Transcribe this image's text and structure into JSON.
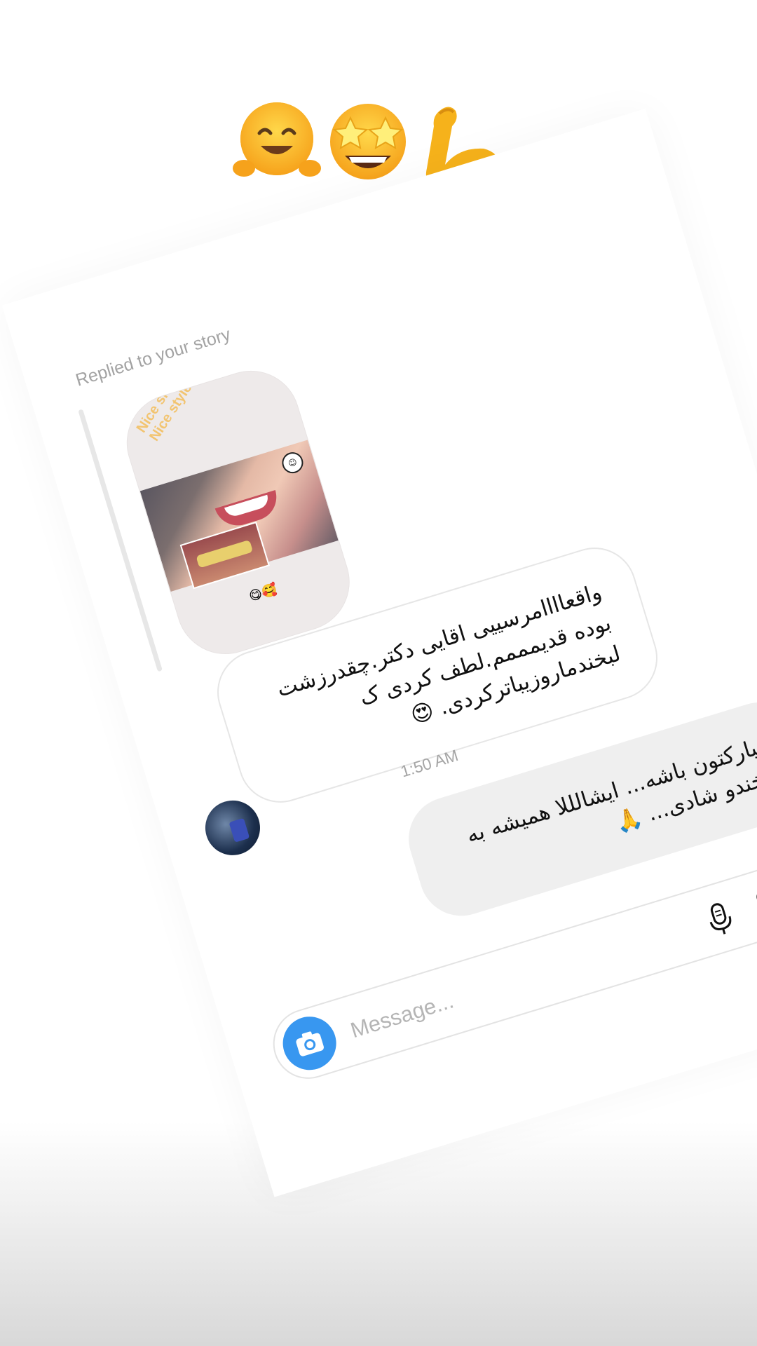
{
  "stickers": [
    {
      "icon": "hugging-face-emoji",
      "glyph": "🤗"
    },
    {
      "icon": "star-struck-emoji",
      "glyph": "🤩"
    },
    {
      "icon": "flexed-biceps-emoji",
      "glyph": "💪"
    }
  ],
  "thread": {
    "replied_label": "Replied to your story",
    "story": {
      "caption_line1": "Nice smile",
      "caption_line2": "Nice style",
      "emoji": "😋🥰"
    },
    "incoming_message": {
      "lines": [
        "واقعاااامرسییی اقایی دکتر.چقدرزشت",
        "بوده قدیمممم.لطف کردی ک",
        "لبخندماروزیباترکردی. 😍"
      ]
    },
    "timestamp": "1:50 AM",
    "outgoing_message": {
      "lines": [
        "مبارکتون باشه... ایشالللا همیشه به",
        "لبخندو شادی... 🙏"
      ]
    }
  },
  "composer": {
    "placeholder": "Message...",
    "camera_icon": "camera-icon",
    "mic_icon": "microphone-icon",
    "gallery_icon": "gallery-icon",
    "plus_icon": "plus-icon"
  },
  "colors": {
    "accent": "#3897f0",
    "incoming_bg": "#ffffff",
    "outgoing_bg": "#efefef",
    "muted_text": "#a5a5a5"
  }
}
